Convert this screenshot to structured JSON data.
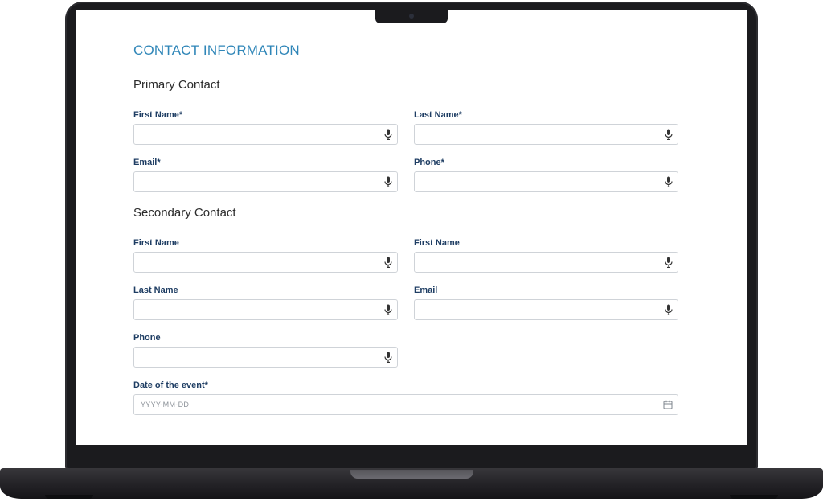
{
  "form": {
    "title": "CONTACT INFORMATION",
    "primary": {
      "heading": "Primary Contact",
      "first_name_label": "First Name*",
      "last_name_label": "Last Name*",
      "email_label": "Email*",
      "phone_label": "Phone*"
    },
    "secondary": {
      "heading": "Secondary Contact",
      "first_name_label": "First Name",
      "first_name_label_2": "First Name",
      "last_name_label": "Last Name",
      "email_label": "Email",
      "phone_label": "Phone"
    },
    "event_date": {
      "label": "Date of the event*",
      "placeholder": "YYYY-MM-DD"
    }
  },
  "icons": {
    "field_input": "microphone-icon",
    "date_input": "calendar-icon"
  },
  "colors": {
    "title": "#2f86b8",
    "label": "#1e3d63",
    "border": "#cfd3d8"
  }
}
